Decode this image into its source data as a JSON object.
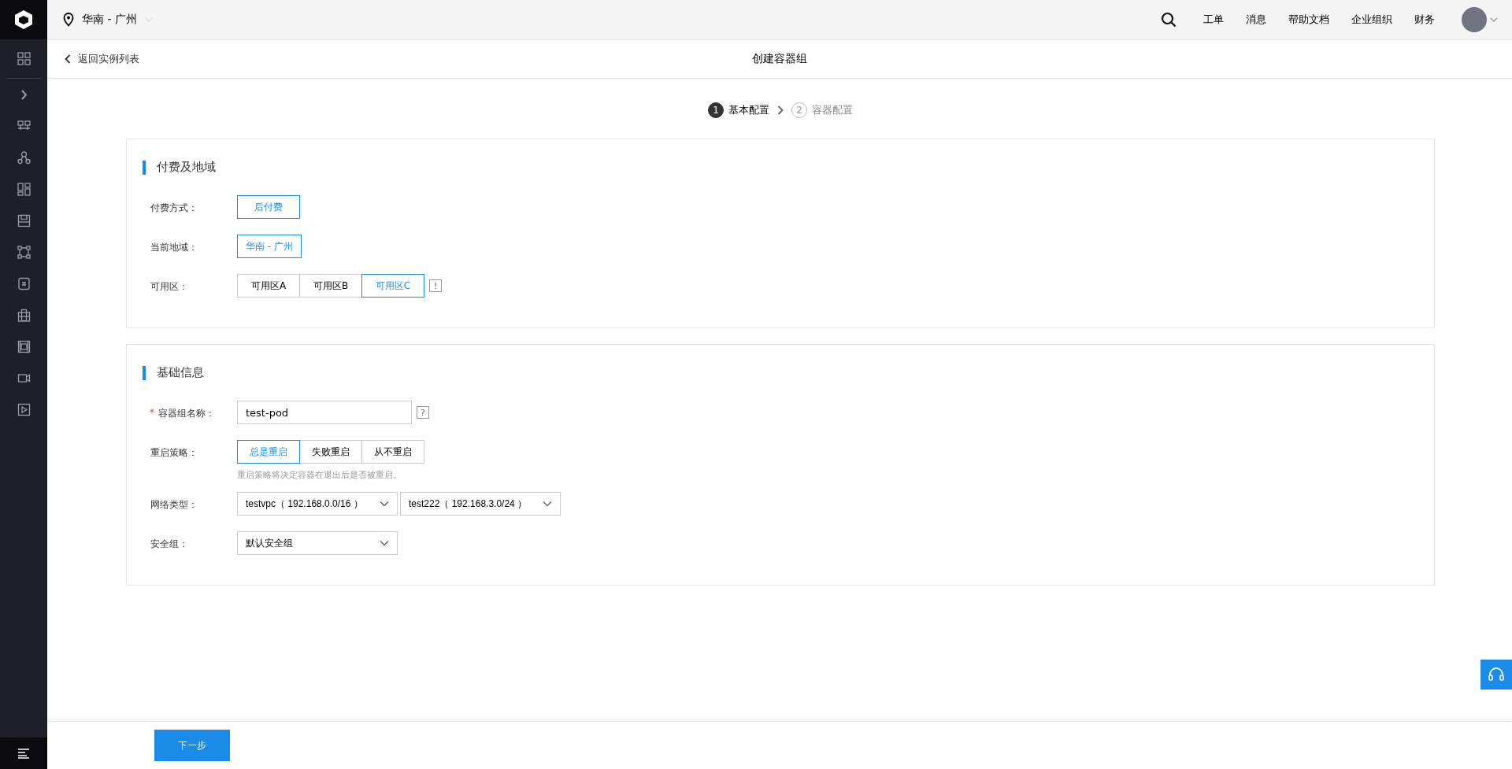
{
  "topbar": {
    "region": "华南 - 广州",
    "links": [
      "工单",
      "消息",
      "帮助文档",
      "企业组织",
      "财务"
    ]
  },
  "header": {
    "back": "返回实例列表",
    "title": "创建容器组"
  },
  "steps": [
    {
      "number": "1",
      "label": "基本配置",
      "selected": true
    },
    {
      "number": "2",
      "label": "容器配置",
      "selected": false
    }
  ],
  "sections": [
    {
      "title": "付费及地域",
      "rows": [
        {
          "kind": "options",
          "label": "付费方式：",
          "options": [
            {
              "label": "后付费",
              "selected": true
            }
          ]
        },
        {
          "kind": "options",
          "label": "当前地域：",
          "options": [
            {
              "label": "华南 - 广州",
              "selected": true
            }
          ]
        },
        {
          "kind": "options",
          "label": "可用区：",
          "help": "!",
          "options": [
            {
              "label": "可用区A",
              "selected": false
            },
            {
              "label": "可用区B",
              "selected": false
            },
            {
              "label": "可用区C",
              "selected": true
            }
          ]
        }
      ]
    },
    {
      "title": "基础信息",
      "rows": [
        {
          "kind": "input",
          "label": "容器组名称：",
          "required_mark": "*",
          "value": "test-pod",
          "help": "?"
        },
        {
          "kind": "options",
          "label": "重启策略：",
          "hint": "重启策略将决定容器在退出后是否被重启。",
          "options": [
            {
              "label": "总是重启",
              "selected": true
            },
            {
              "label": "失败重启",
              "selected": false
            },
            {
              "label": "从不重启",
              "selected": false
            }
          ]
        },
        {
          "kind": "selects",
          "label": "网络类型：",
          "selects": [
            "testvpc（ 192.168.0.0/16 ）",
            "test222（ 192.168.3.0/24 ）"
          ]
        },
        {
          "kind": "selects",
          "label": "安全组：",
          "selects": [
            "默认安全组"
          ]
        }
      ]
    }
  ],
  "footer": {
    "next": "下一步"
  }
}
